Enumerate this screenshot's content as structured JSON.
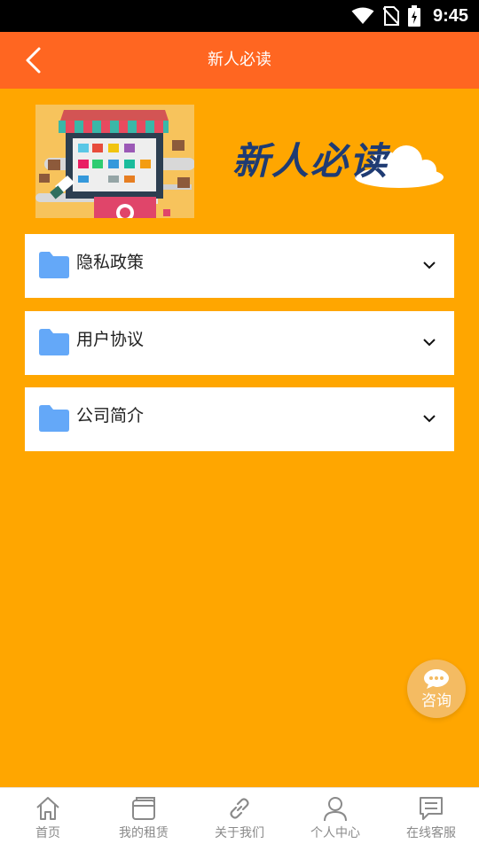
{
  "status_bar": {
    "time": "9:45",
    "icons": [
      "wifi-icon",
      "no-sim-icon",
      "battery-icon"
    ]
  },
  "app_bar": {
    "title": "新人必读",
    "back_icon": "back-arrow-icon",
    "background_color": "#ff6621"
  },
  "banner": {
    "image": "storefront-illustration",
    "text": "新人必读"
  },
  "sections": [
    {
      "label": "隐私政策",
      "icon": "folder-icon",
      "chevron": "chevron-down-icon"
    },
    {
      "label": "用户协议",
      "icon": "folder-icon",
      "chevron": "chevron-down-icon"
    },
    {
      "label": "公司简介",
      "icon": "folder-icon",
      "chevron": "chevron-down-icon"
    }
  ],
  "consult": {
    "label": "咨询",
    "icon": "chat-bubble-icon"
  },
  "bottom_nav": [
    {
      "label": "首页",
      "icon": "home-icon"
    },
    {
      "label": "我的租赁",
      "icon": "wallet-icon"
    },
    {
      "label": "关于我们",
      "icon": "link-icon"
    },
    {
      "label": "个人中心",
      "icon": "user-icon"
    },
    {
      "label": "在线客服",
      "icon": "message-icon"
    }
  ],
  "colors": {
    "page_background": "#ffa600",
    "app_bar": "#ff6621",
    "folder": "#64a8f8",
    "consult_button": "#f4bb62",
    "nav_text": "#8a8a8a"
  }
}
